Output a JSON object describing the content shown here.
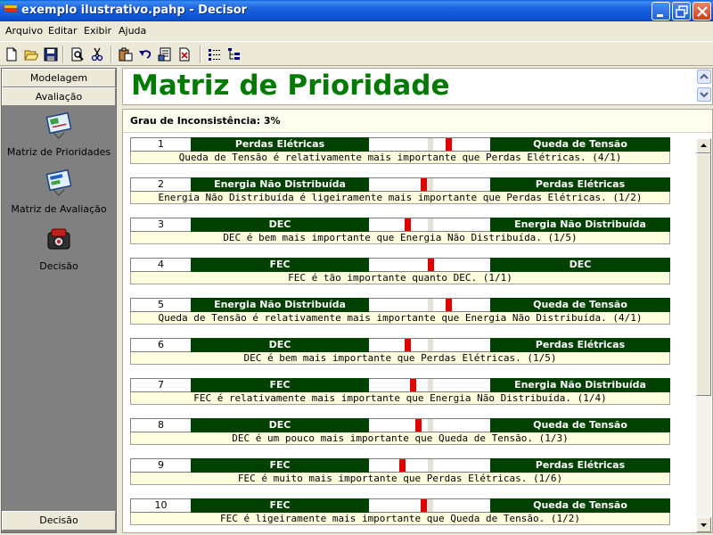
{
  "window": {
    "title": "exemplo ilustrativo.pahp - Decisor"
  },
  "menu": [
    "Arquivo",
    "Editar",
    "Exibir",
    "Ajuda"
  ],
  "toolbar": {
    "icons": [
      "new-file-icon",
      "open-folder-icon",
      "save-icon",
      "print-preview-icon",
      "cut-icon",
      "paste-icon",
      "undo-icon",
      "properties-icon",
      "delete-icon",
      "list-view-icon",
      "tree-view-icon"
    ]
  },
  "sidebar": {
    "tabs": [
      "Modelagem",
      "Avaliação"
    ],
    "items": [
      {
        "label": "Matriz de Prioridades",
        "icon": "matrix-chart-icon"
      },
      {
        "label": "Matriz de Avaliação",
        "icon": "evaluation-matrix-icon"
      },
      {
        "label": "Decisão",
        "icon": "decision-icon"
      }
    ],
    "bottom_tab": "Decisão"
  },
  "header": {
    "title": "Matriz de Prioridade"
  },
  "inconsistency": {
    "label": "Grau de Inconsistência:",
    "value": "3%"
  },
  "comparisons": [
    {
      "num": "1",
      "left": "Perdas Elétricas",
      "right": "Queda de Tensão",
      "scale": 4,
      "desc": "Queda de Tensão é relativamente mais importante que Perdas Elétricas.  (4/1)"
    },
    {
      "num": "2",
      "left": "Energia Não Distribuída",
      "right": "Perdas Elétricas",
      "scale": -2,
      "desc": "Energia Não Distribuída é ligeiramente mais importante que Perdas Elétricas.  (1/2)"
    },
    {
      "num": "3",
      "left": "DEC",
      "right": "Energia Não Distribuída",
      "scale": -5,
      "desc": "DEC é bem mais importante que Energia Não Distribuída.  (1/5)"
    },
    {
      "num": "4",
      "left": "FEC",
      "right": "DEC",
      "scale": 1,
      "desc": "FEC é tão importante quanto DEC.  (1/1)"
    },
    {
      "num": "5",
      "left": "Energia Não Distribuída",
      "right": "Queda de Tensão",
      "scale": 4,
      "desc": "Queda de Tensão é relativamente mais importante que Energia Não Distribuída.  (4/1)"
    },
    {
      "num": "6",
      "left": "DEC",
      "right": "Perdas Elétricas",
      "scale": -5,
      "desc": "DEC é bem mais importante que Perdas Elétricas.  (1/5)"
    },
    {
      "num": "7",
      "left": "FEC",
      "right": "Energia Não Distribuída",
      "scale": -4,
      "desc": "FEC é relativamente mais importante que Energia Não Distribuída.  (1/4)"
    },
    {
      "num": "8",
      "left": "DEC",
      "right": "Queda de Tensão",
      "scale": -3,
      "desc": "DEC é um pouco mais importante que Queda de Tensão.  (1/3)"
    },
    {
      "num": "9",
      "left": "FEC",
      "right": "Perdas Elétricas",
      "scale": -6,
      "desc": "FEC é muito mais importante que Perdas Elétricas.  (1/6)"
    },
    {
      "num": "10",
      "left": "FEC",
      "right": "Queda de Tensão",
      "scale": -2,
      "desc": "FEC é ligeiramente mais importante que Queda de Tensão.  (1/2)"
    }
  ],
  "colors": {
    "title_green": "#007a00",
    "criterion_bg": "#004000",
    "marker_red": "#e00000",
    "desc_bg": "#ffffe0"
  }
}
